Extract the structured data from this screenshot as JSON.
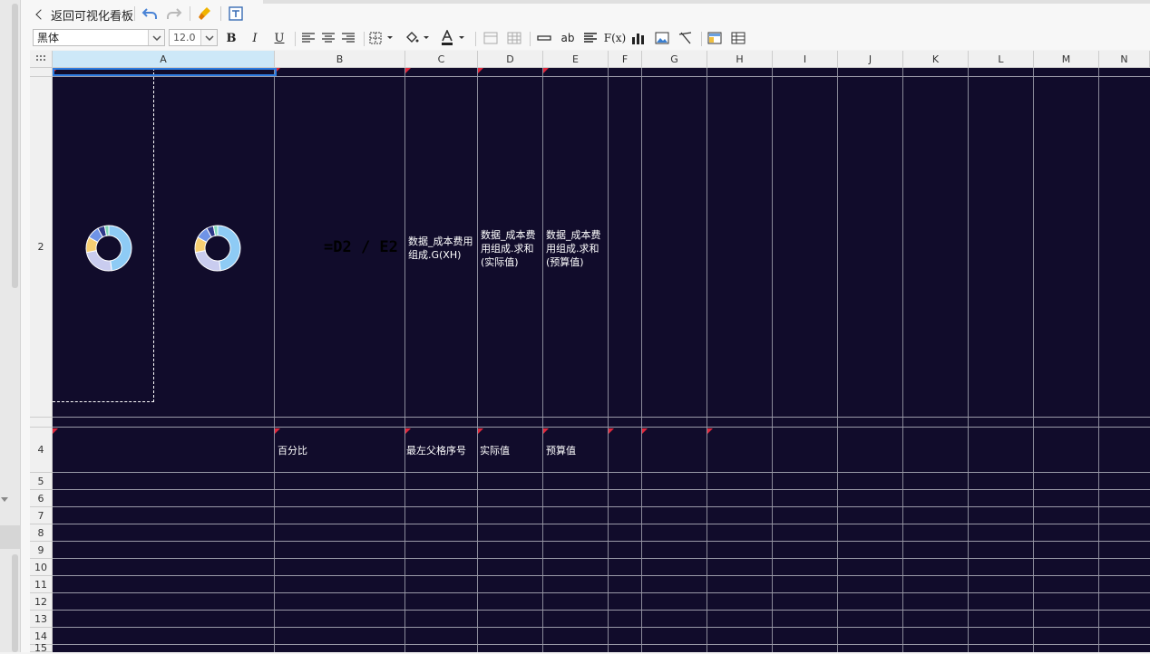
{
  "toolbar": {
    "back_label": "返回可视化看板",
    "font_family_value": "黑体",
    "font_size_value": "12.0",
    "bold_label": "B",
    "italic_label": "I",
    "underline_label": "U",
    "text_label": "ab",
    "fx_label": "F(x)"
  },
  "columns": [
    {
      "label": "A",
      "selected": true
    },
    {
      "label": "B"
    },
    {
      "label": "C"
    },
    {
      "label": "D"
    },
    {
      "label": "E"
    },
    {
      "label": "F"
    },
    {
      "label": "G"
    },
    {
      "label": "H"
    },
    {
      "label": "I"
    },
    {
      "label": "J"
    },
    {
      "label": "K"
    },
    {
      "label": "L"
    },
    {
      "label": "M"
    },
    {
      "label": "N"
    }
  ],
  "rows": [
    "",
    "2",
    "",
    "4",
    "5",
    "6",
    "7",
    "8",
    "9",
    "10",
    "11",
    "12",
    "13",
    "14",
    "15"
  ],
  "cells": {
    "b2_formula": "=D2 / E2",
    "c2": "数据_成本费用组成.G(XH)",
    "d2": "数据_成本费用组成.求和(实际值)",
    "e2": "数据_成本费用组成.求和(预算值)",
    "b4": "百分比",
    "c4": "最左父格序号",
    "d4": "实际值",
    "e4": "预算值"
  },
  "donut": {
    "segments": [
      {
        "value": 48,
        "color": "#8ecbf5"
      },
      {
        "value": 24,
        "color": "#c9ccef"
      },
      {
        "value": 11,
        "color": "#f7cf73"
      },
      {
        "value": 9,
        "color": "#6f93e6"
      },
      {
        "value": 5,
        "color": "#2f3a8a"
      },
      {
        "value": 3,
        "color": "#7fd9b8"
      }
    ]
  },
  "colors": {
    "sheet_bg": "#110c2b",
    "selection": "#2d7be0",
    "flag": "#e0283c"
  }
}
